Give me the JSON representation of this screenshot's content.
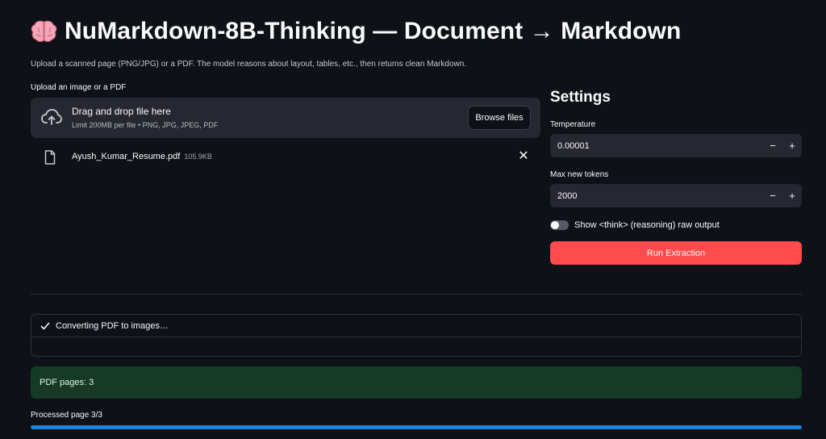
{
  "header": {
    "title_icon": "brain-icon",
    "title": "NuMarkdown-8B-Thinking — Document → Markdown",
    "subtitle": "Upload a scanned page (PNG/JPG) or a PDF. The model reasons about layout, tables, etc., then returns clean Markdown."
  },
  "uploader": {
    "label": "Upload an image or a PDF",
    "drop_title": "Drag and drop file here",
    "drop_subtitle": "Limit 200MB per file • PNG, JPG, JPEG, PDF",
    "browse_label": "Browse files",
    "file": {
      "name": "Ayush_Kumar_Resume.pdf",
      "size": "105.9KB",
      "remove_icon": "close-icon"
    }
  },
  "settings": {
    "title": "Settings",
    "temperature": {
      "label": "Temperature",
      "value": "0.00001",
      "minus": "−",
      "plus": "+"
    },
    "max_tokens": {
      "label": "Max new tokens",
      "value": "2000",
      "minus": "−",
      "plus": "+"
    },
    "toggle": {
      "label": "Show <think> (reasoning) raw output",
      "checked": false
    },
    "run_label": "Run Extraction"
  },
  "status": {
    "text": "Converting PDF to images…",
    "icon": "check-icon"
  },
  "info": {
    "text": "PDF pages: 3"
  },
  "progress": {
    "label": "Processed page 3/3",
    "fraction": 1.0
  },
  "colors": {
    "background": "#0e1117",
    "surface": "#262730",
    "primary_button": "#ff4b4b",
    "success_bg": "#173928",
    "progress": "#1c83e1"
  }
}
